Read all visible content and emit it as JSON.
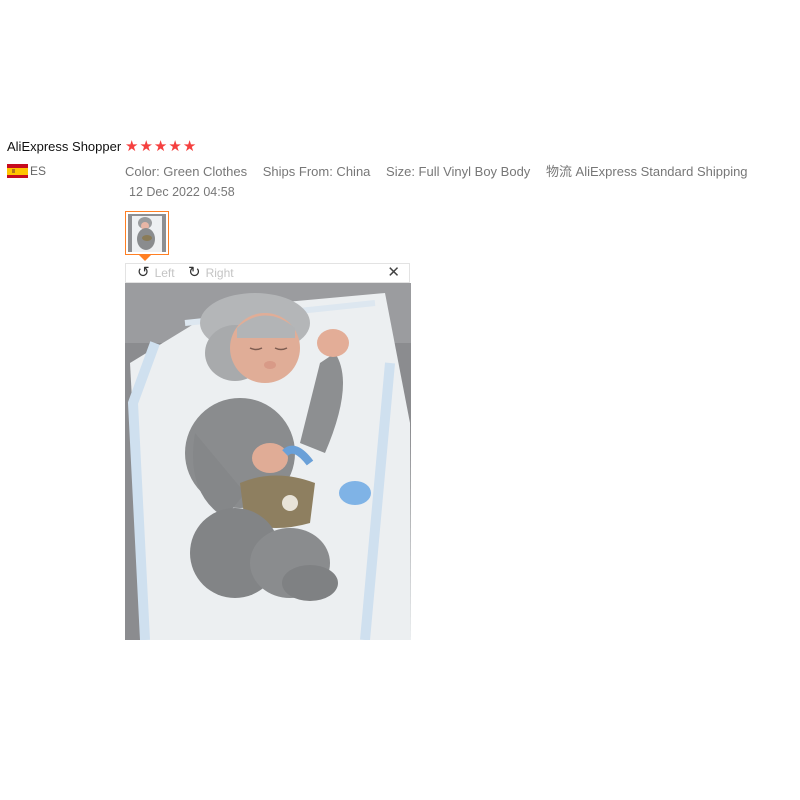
{
  "review": {
    "reviewer": "AliExpress Shopper",
    "rating": 5,
    "country_code": "ES",
    "attributes": [
      "Color: Green Clothes",
      "Ships From: China",
      "Size: Full Vinyl Boy Body",
      "物流 AliExpress Standard Shipping"
    ],
    "date": "12 Dec 2022 04:58"
  },
  "viewer": {
    "rotate_left_label": "Left",
    "rotate_right_label": "Right",
    "rotate_left_icon": "rotate-left-icon",
    "rotate_right_icon": "rotate-right-icon",
    "close_icon": "close-icon"
  },
  "colors": {
    "star": "#f5403f",
    "thumb_border": "#ff7f23",
    "meta_text": "#777777"
  }
}
